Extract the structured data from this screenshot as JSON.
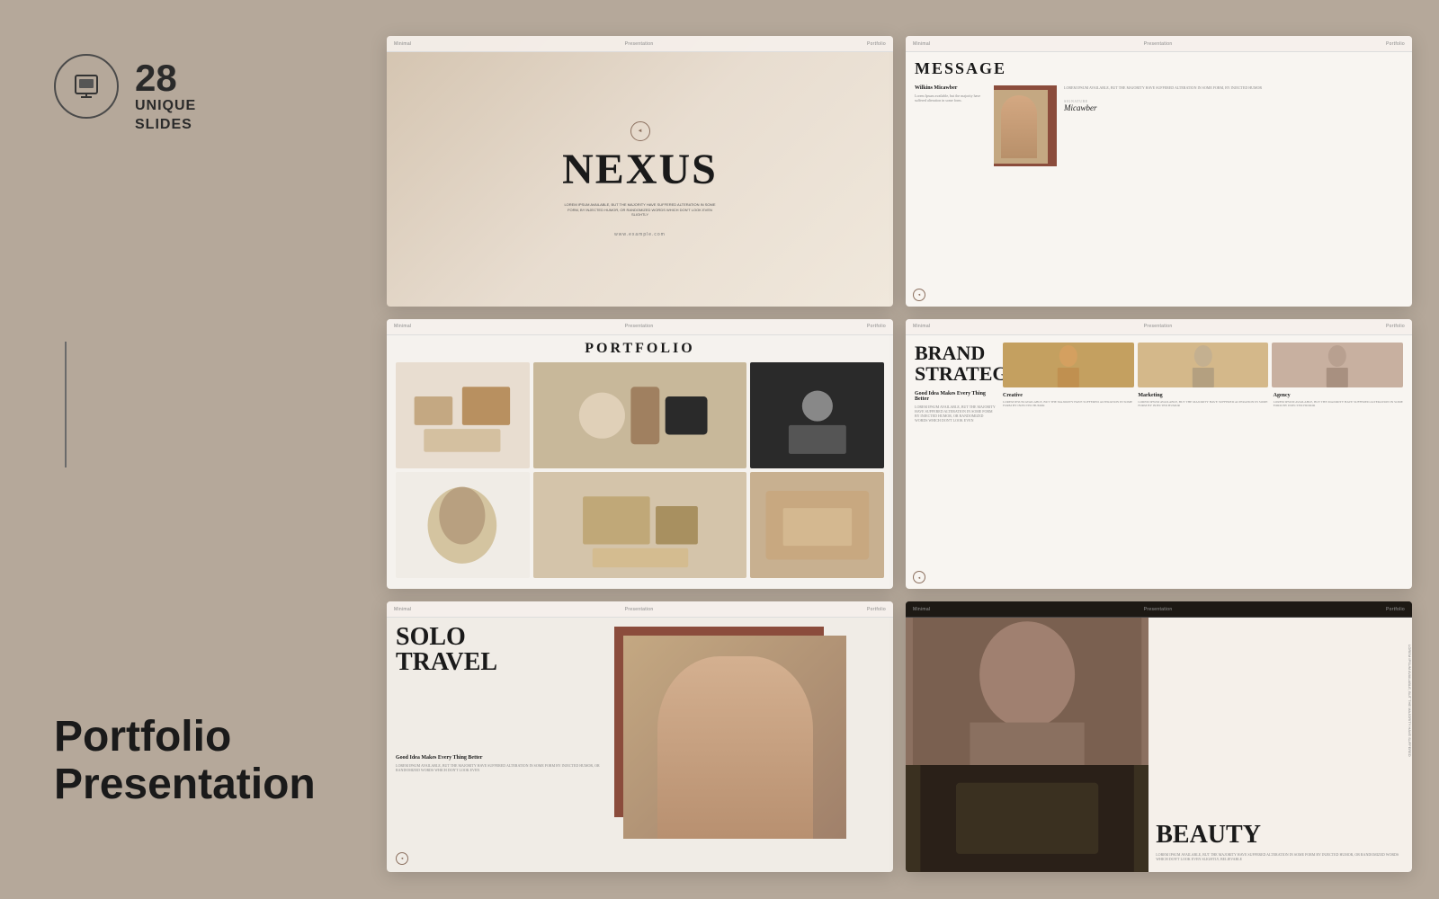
{
  "left": {
    "badge_number": "28",
    "badge_label_line1": "UNIQUE",
    "badge_label_line2": "SLIDES",
    "bottom_title_line1": "Portfolio",
    "bottom_title_line2": "Presentation"
  },
  "slides": {
    "slide1": {
      "nav_left": "Minimal",
      "nav_center": "Presentation",
      "nav_right": "Portfolio",
      "title": "NEXUS",
      "subtitle": "LOREM IPSUM AVAILABLE, BUT THE MAJORITY HAVE SUFFERED ALTERATION IN SOME FORM, BY INJECTED HUMOR, OR RANDOMIZED WORDS WHICH DON'T LOOK EVEN SLIGHTLY",
      "url": "www.example.com"
    },
    "slide2": {
      "nav_left": "Minimal",
      "nav_center": "Presentation",
      "nav_right": "Portfolio",
      "title": "MESSAGE",
      "person_name": "Wilkins Micawber",
      "person_desc": "Lorem Ipsum available, but the majority have suffered alteration in some form.",
      "body_text": "LOREM IPSUM AVAILABLE, BUT THE MAJORITY HAVE SUFFERED ALTERATION IN SOME FORM, BY INJECTED HUMOR",
      "signature_label": "SIGNATURE",
      "signature_name": "Micawber"
    },
    "slide3": {
      "nav_left": "Minimal",
      "nav_center": "Presentation",
      "nav_right": "Portfolio",
      "title": "PORTFOLIO"
    },
    "slide4": {
      "nav_left": "Minimal",
      "nav_center": "Presentation",
      "nav_right": "Portfolio",
      "title_line1": "BRAND",
      "title_line2": "STRATEGY",
      "subtitle": "Good Idea Makes Every Thing Better",
      "desc": "LOREM IPSUM AVAILABLE, BUT THE MAJORITY HAVE SUFFERED ALTERATION IN SOME FORM BY INJECTED HUMOR, OR RANDOMIZED WORDS WHICH DON'T LOOK EVEN",
      "col1_title": "Creative",
      "col1_text": "LOREM IPSUM AVAILABLE, BUT THE MAJORITY HAVE SUFFERED ALTERATION IN SOME FORM BY INJECTED HUMOR",
      "col2_title": "Marketing",
      "col2_text": "LOREM IPSUM AVAILABLE, BUT THE MAJORITY HAVE SUFFERED ALTERATION IN SOME FORM BY INJECTED HUMOR",
      "col3_title": "Agency",
      "col3_text": "LOREM IPSUM AVAILABLE, BUT THE MAJORITY HAVE SUFFERED ALTERATION IN SOME FORM BY INJECTED HUMOR"
    },
    "slide5": {
      "nav_left": "Minimal",
      "nav_center": "Presentation",
      "nav_right": "Portfolio",
      "title_line1": "SOLO",
      "title_line2": "TRAVEL",
      "subtitle": "Good Idea Makes Every Thing Better",
      "desc": "LOREM IPSUM AVAILABLE, BUT THE MAJORITY HAVE SUFFERED ALTERATION IN SOME FORM BY INJECTED HUMOR, OR RANDOMIZED WORDS WHICH DON'T LOOK EVEN"
    },
    "slide6": {
      "nav_left": "Minimal",
      "nav_center": "Presentation",
      "nav_right": "Portfolio",
      "title": "BEAUTY",
      "desc": "LOREM IPSUM AVAILABLE, BUT THE MAJORITY HAVE SUFFERED ALTERATION IN SOME FORM BY INJECTED HUMOR, OR RANDOMIZED WORDS WHICH DON'T LOOK EVEN SLIGHTLY, BELIEVABLE",
      "side_text": "LOREM IPSUM AVAILABLE, BUT THE MAJORITY HAVE SUFFERED"
    }
  }
}
